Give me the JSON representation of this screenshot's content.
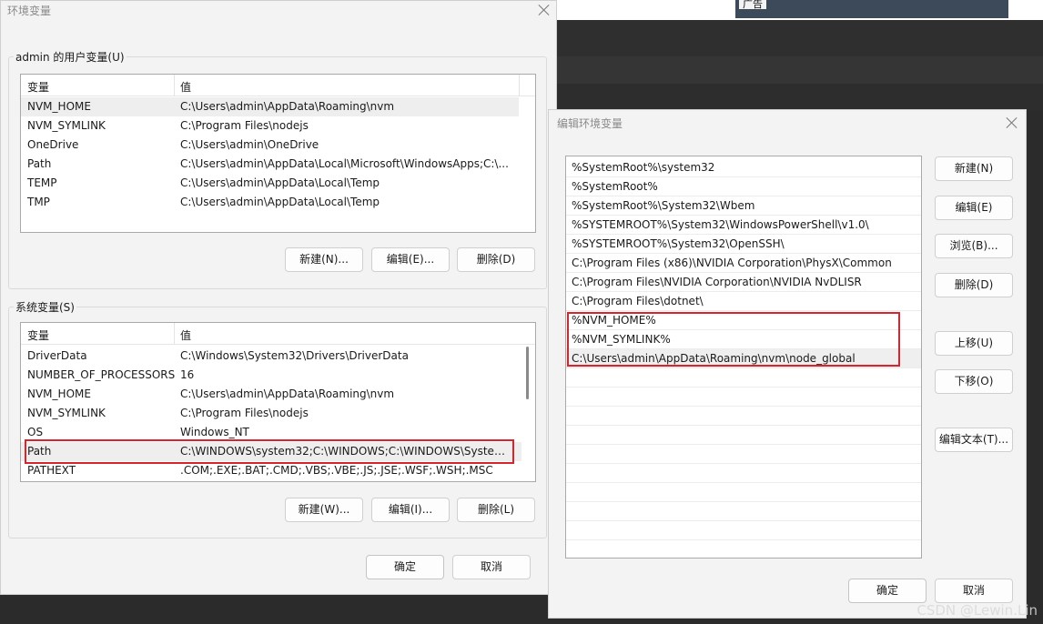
{
  "env_dialog": {
    "title": "环境变量",
    "user_group_label": "admin 的用户变量(U)",
    "system_group_label": "系统变量(S)",
    "col_variable": "变量",
    "col_value": "值",
    "user_vars": [
      {
        "name": "NVM_HOME",
        "value": "C:\\Users\\admin\\AppData\\Roaming\\nvm"
      },
      {
        "name": "NVM_SYMLINK",
        "value": "C:\\Program Files\\nodejs"
      },
      {
        "name": "OneDrive",
        "value": "C:\\Users\\admin\\OneDrive"
      },
      {
        "name": "Path",
        "value": "C:\\Users\\admin\\AppData\\Local\\Microsoft\\WindowsApps;C:\\..."
      },
      {
        "name": "TEMP",
        "value": "C:\\Users\\admin\\AppData\\Local\\Temp"
      },
      {
        "name": "TMP",
        "value": "C:\\Users\\admin\\AppData\\Local\\Temp"
      }
    ],
    "system_vars": [
      {
        "name": "DriverData",
        "value": "C:\\Windows\\System32\\Drivers\\DriverData"
      },
      {
        "name": "NUMBER_OF_PROCESSORS",
        "value": "16"
      },
      {
        "name": "NVM_HOME",
        "value": "C:\\Users\\admin\\AppData\\Roaming\\nvm"
      },
      {
        "name": "NVM_SYMLINK",
        "value": "C:\\Program Files\\nodejs"
      },
      {
        "name": "OS",
        "value": "Windows_NT"
      },
      {
        "name": "Path",
        "value": "C:\\WINDOWS\\system32;C:\\WINDOWS;C:\\WINDOWS\\System..."
      },
      {
        "name": "PATHEXT",
        "value": ".COM;.EXE;.BAT;.CMD;.VBS;.VBE;.JS;.JSE;.WSF;.WSH;.MSC"
      }
    ],
    "user_buttons": {
      "new": "新建(N)...",
      "edit": "编辑(E)...",
      "delete": "删除(D)"
    },
    "system_buttons": {
      "new": "新建(W)...",
      "edit": "编辑(I)...",
      "delete": "删除(L)"
    },
    "ok": "确定",
    "cancel": "取消"
  },
  "edit_dialog": {
    "title": "编辑环境变量",
    "entries": [
      "%SystemRoot%\\system32",
      "%SystemRoot%",
      "%SystemRoot%\\System32\\Wbem",
      "%SYSTEMROOT%\\System32\\WindowsPowerShell\\v1.0\\",
      "%SYSTEMROOT%\\System32\\OpenSSH\\",
      "C:\\Program Files (x86)\\NVIDIA Corporation\\PhysX\\Common",
      "C:\\Program Files\\NVIDIA Corporation\\NVIDIA NvDLISR",
      "C:\\Program Files\\dotnet\\",
      "%NVM_HOME%",
      "%NVM_SYMLINK%",
      "C:\\Users\\admin\\AppData\\Roaming\\nvm\\node_global"
    ],
    "buttons": {
      "new": "新建(N)",
      "edit": "编辑(E)",
      "browse": "浏览(B)...",
      "delete": "删除(D)",
      "move_up": "上移(U)",
      "move_down": "下移(O)",
      "edit_text": "编辑文本(T)..."
    },
    "ok": "确定",
    "cancel": "取消"
  },
  "background": {
    "thumb_label": "广告"
  },
  "watermark": "CSDN @Lewin.Lin"
}
